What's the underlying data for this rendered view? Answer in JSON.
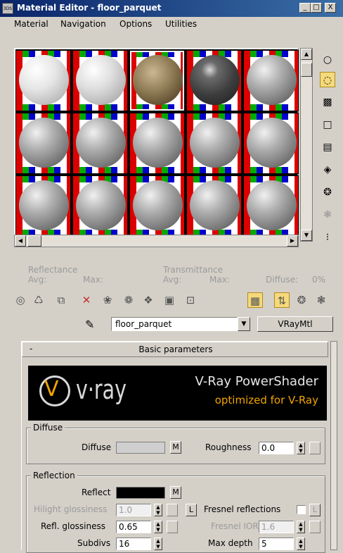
{
  "window": {
    "title": "Material Editor - floor_parquet",
    "buttons": [
      "_",
      "□",
      "X"
    ]
  },
  "menu": [
    "Material",
    "Navigation",
    "Options",
    "Utilities"
  ],
  "slots": [
    {
      "style": "white"
    },
    {
      "style": "textured"
    },
    {
      "style": "parquet"
    },
    {
      "style": "dark"
    },
    {
      "style": "default"
    },
    {
      "style": "default"
    },
    {
      "style": "default"
    },
    {
      "style": "default"
    },
    {
      "style": "default"
    },
    {
      "style": "default"
    },
    {
      "style": "default"
    },
    {
      "style": "default"
    },
    {
      "style": "default"
    },
    {
      "style": "default"
    },
    {
      "style": "default"
    }
  ],
  "info": {
    "reflectance": "Reflectance",
    "transmittance": "Transmittance",
    "avg": "Avg:",
    "max": "Max:",
    "avg2": "Avg:",
    "max2": "Max:",
    "diffuse": "Diffuse:",
    "diffuse_value": "0%"
  },
  "material": {
    "name": "floor_parquet",
    "type": "VRayMtl"
  },
  "rollout": {
    "title": "Basic parameters",
    "collapse": "-"
  },
  "banner": {
    "logo": "v·ray",
    "line1": "V-Ray PowerShader",
    "line2": "optimized for V-Ray"
  },
  "diffuse_group": {
    "label": "Diffuse",
    "diffuse_label": "Diffuse",
    "diffuse_color": "#cfcfcf",
    "m": "M",
    "roughness_label": "Roughness",
    "roughness_value": "0.0"
  },
  "reflection_group": {
    "label": "Reflection",
    "reflect_label": "Reflect",
    "reflect_color": "#000000",
    "m": "M",
    "hilight_label": "Hilight glossiness",
    "hilight_value": "1.0",
    "l": "L",
    "fresnel_label": "Fresnel reflections",
    "l2": "L",
    "refl_gloss_label": "Refl. glossiness",
    "refl_gloss_value": "0.65",
    "fresnel_ior_label": "Fresnel IOR",
    "fresnel_ior_value": "1.6",
    "subdivs_label": "Subdivs",
    "subdivs_value": "16",
    "max_depth_label": "Max depth",
    "max_depth_value": "5"
  },
  "colors": {
    "title_bar": "#0a246a",
    "face": "#d4d0c8",
    "accent": "#f2a400"
  }
}
